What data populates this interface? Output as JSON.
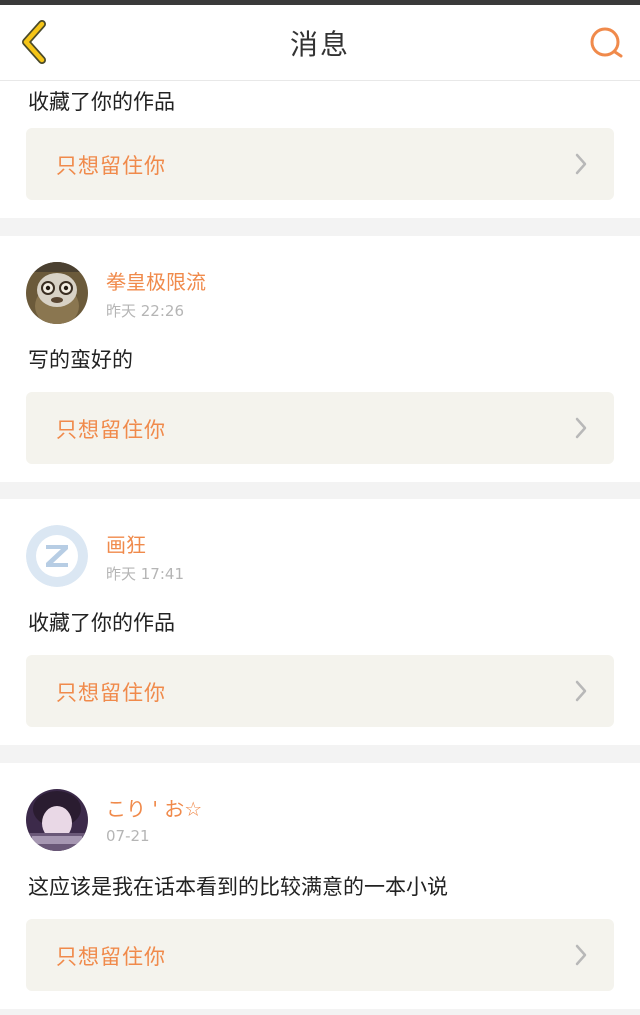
{
  "header": {
    "title": "消息",
    "back_icon": "chevron-left-icon",
    "search_icon": "search-icon",
    "accent_color": "#f08a4b"
  },
  "messages": [
    {
      "user_name": "",
      "time": "",
      "text": "收藏了你的作品",
      "work_title": "只想留住你"
    },
    {
      "user_name": "拳皇极限流",
      "time": "昨天 22:26",
      "text": "写的蛮好的",
      "work_title": "只想留住你"
    },
    {
      "user_name": "画狂",
      "time": "昨天 17:41",
      "text": "收藏了你的作品",
      "work_title": "只想留住你"
    },
    {
      "user_name": "こり ' お☆",
      "time": "07-21",
      "text": "这应该是我在话本看到的比较满意的一本小说",
      "work_title": "只想留住你"
    }
  ]
}
